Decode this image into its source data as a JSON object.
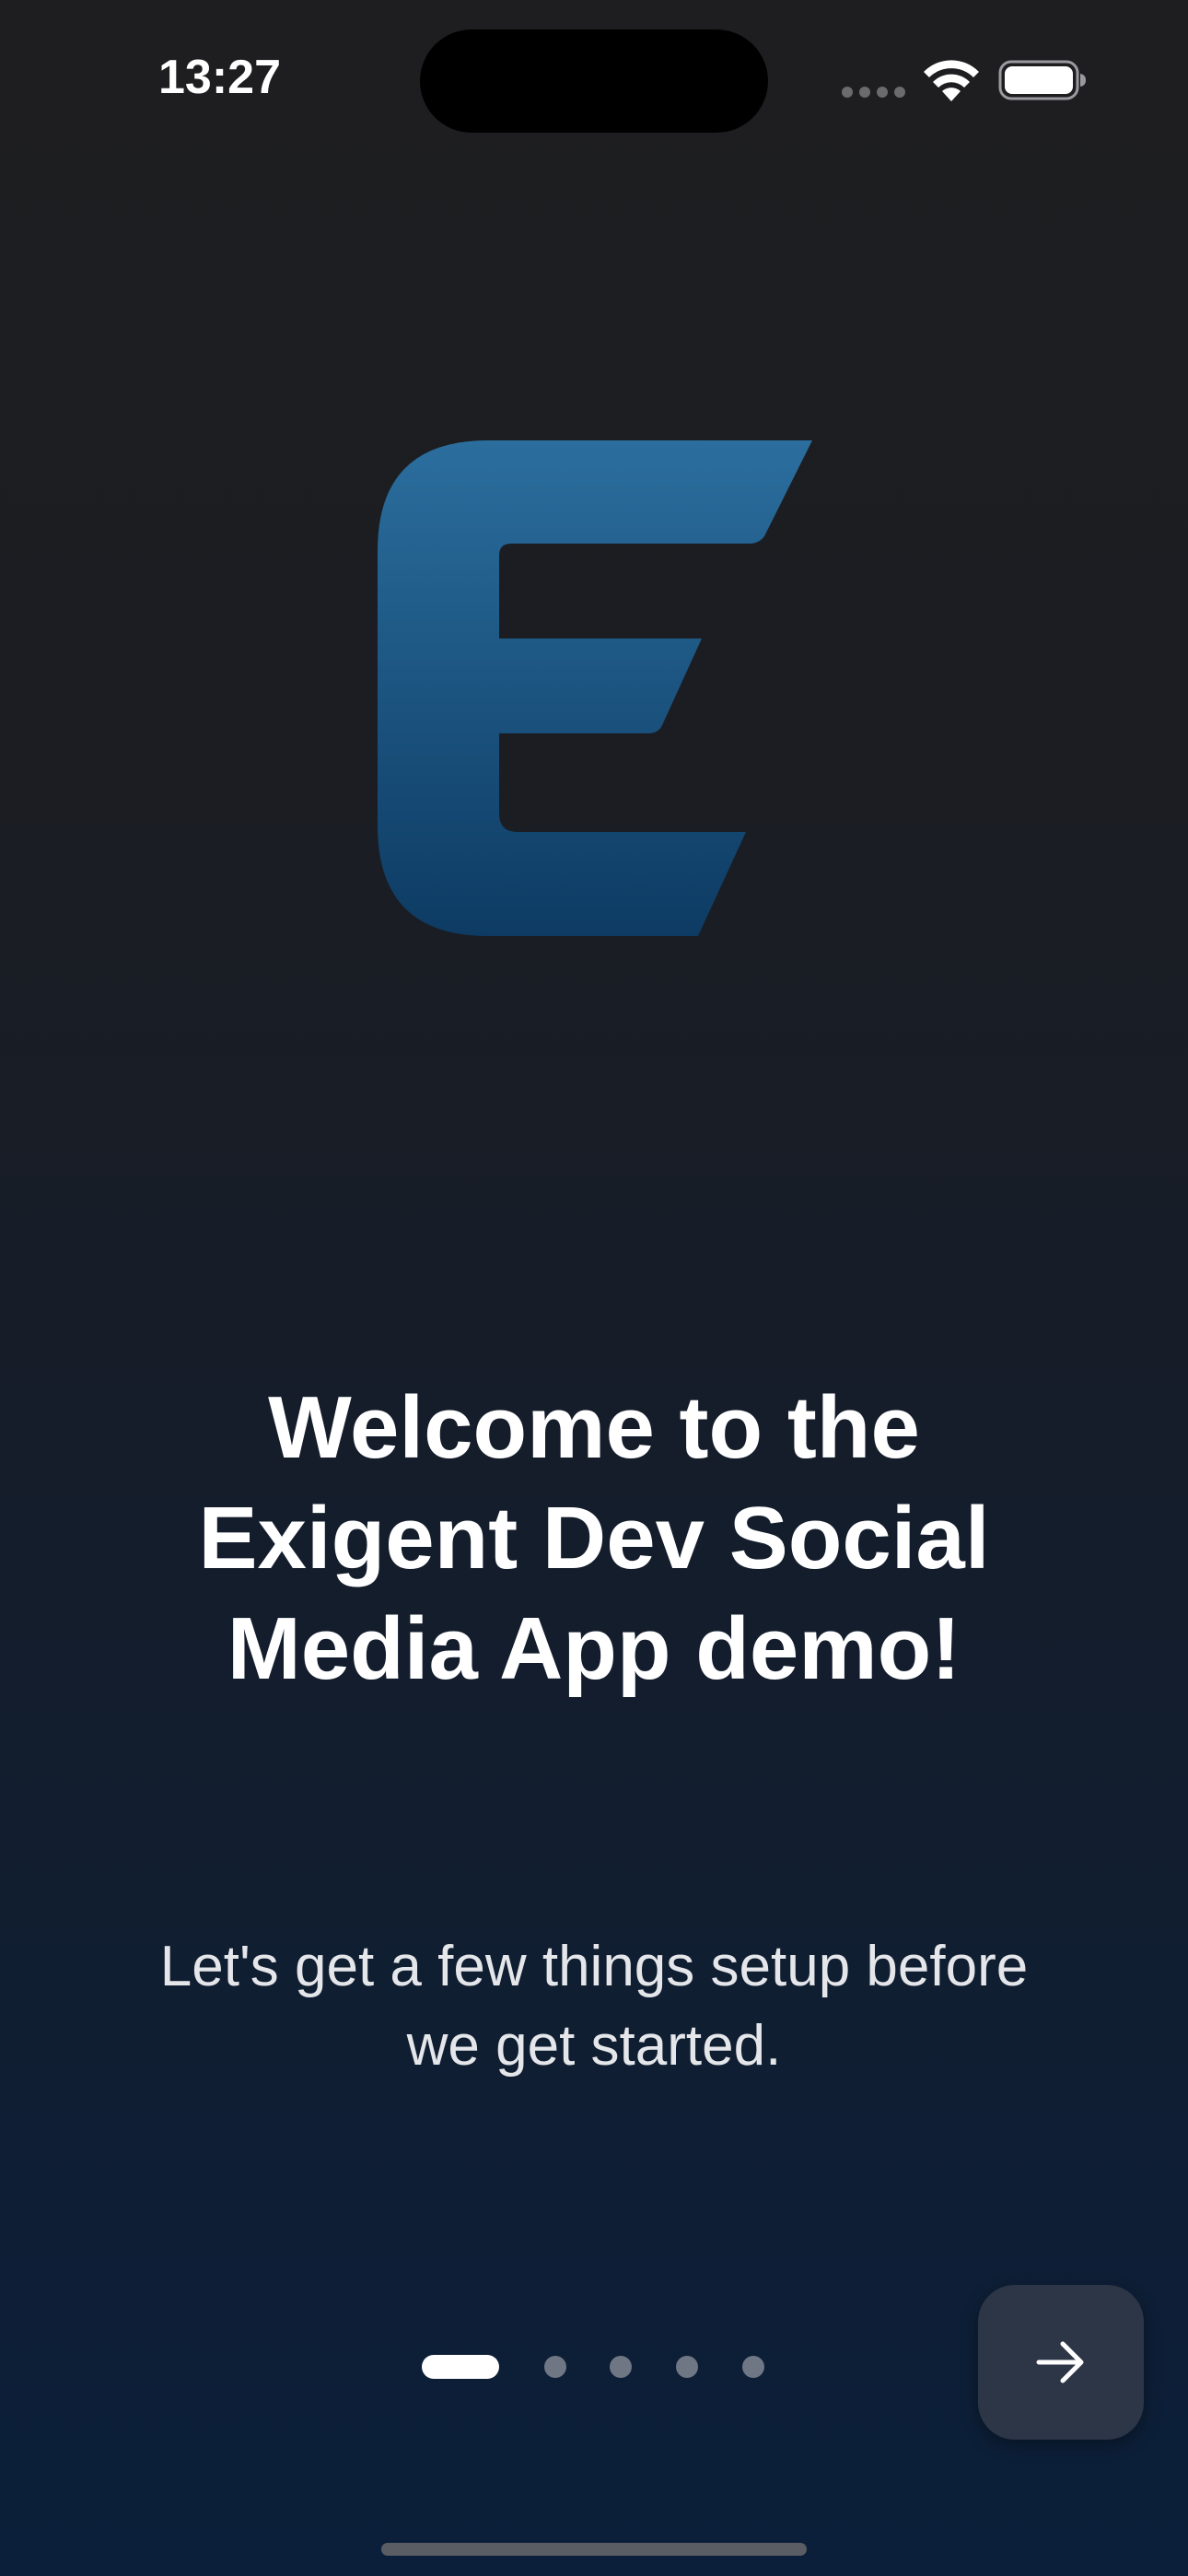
{
  "status_bar": {
    "time": "13:27",
    "icons": [
      "cellular-signal-icon",
      "wifi-icon",
      "battery-icon"
    ]
  },
  "logo": {
    "icon": "exigent-e-logo-icon",
    "color_top": "#2b6e9e",
    "color_bottom": "#0d3b63"
  },
  "onboarding": {
    "headline_lines": [
      "Welcome to the",
      "Exigent Dev Social",
      "Media App demo!"
    ],
    "subtitle_lines": [
      "Let's get a few things setup before",
      "we get started."
    ]
  },
  "pager": {
    "total_pages": 5,
    "current_page": 1
  },
  "next_button": {
    "icon": "arrow-right-icon"
  },
  "colors": {
    "background_top": "#1e1e20",
    "background_bottom": "#0b1f3a",
    "button_bg": "#2d3647",
    "text": "#ffffff"
  }
}
